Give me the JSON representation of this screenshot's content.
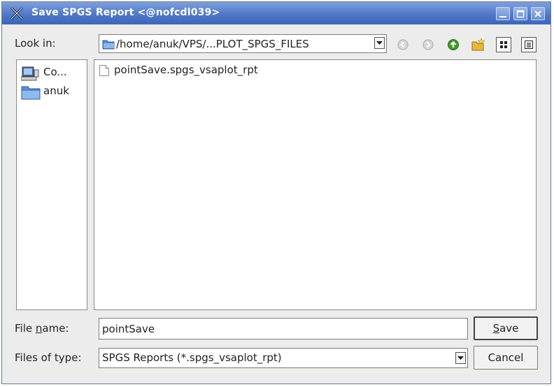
{
  "window": {
    "title": "Save SPGS Report <@nofcdl039>",
    "minimize_icon": "minimize-icon",
    "maximize_icon": "maximize-icon",
    "close_icon": "close-icon",
    "title_bar_color": "#4f78c8"
  },
  "lookin": {
    "label": "Look in:",
    "path": "/home/anuk/VPS/...PLOT_SPGS_FILES"
  },
  "toolbar": {
    "icons": [
      "back-icon",
      "forward-icon",
      "up-folder-icon",
      "new-folder-icon",
      "list-view-icon",
      "details-view-icon"
    ]
  },
  "sidebar": {
    "items": [
      {
        "label": "Co...",
        "icon": "computer-icon"
      },
      {
        "label": "anuk",
        "icon": "folder-icon"
      }
    ]
  },
  "files": [
    {
      "name": "pointSave.spgs_vsaplot_rpt",
      "icon": "file-icon"
    }
  ],
  "filename": {
    "label_prefix": "File ",
    "label_underlined": "n",
    "label_suffix": "ame:",
    "value": "pointSave"
  },
  "filetype": {
    "label": "Files of type:",
    "value": "SPGS Reports (*.spgs_vsaplot_rpt)"
  },
  "buttons": {
    "save_underlined": "S",
    "save_rest": "ave",
    "cancel": "Cancel"
  }
}
